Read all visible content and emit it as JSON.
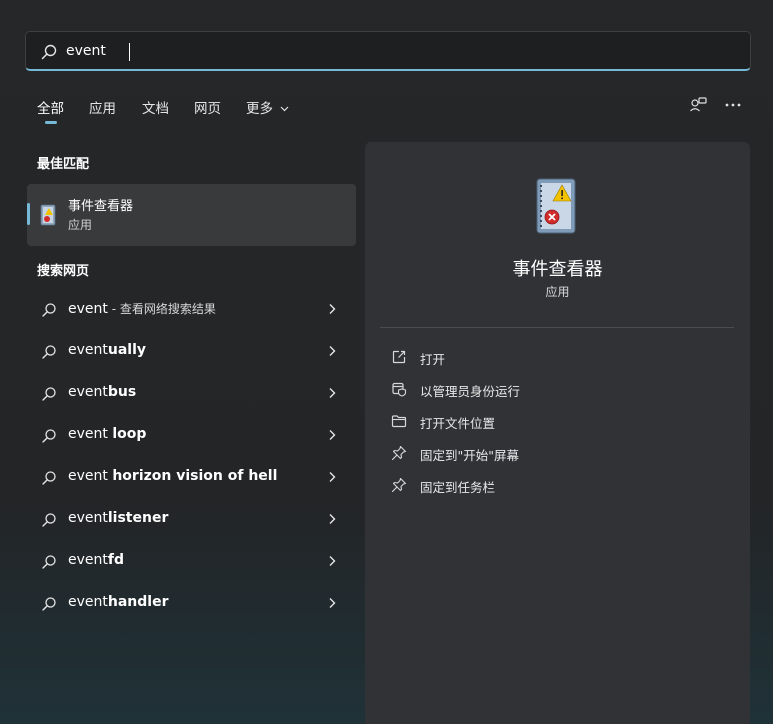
{
  "search": {
    "value": "event",
    "placeholder": ""
  },
  "tabs": [
    {
      "label": "全部",
      "active": true
    },
    {
      "label": "应用"
    },
    {
      "label": "文档"
    },
    {
      "label": "网页"
    },
    {
      "label": "更多"
    }
  ],
  "sections": {
    "best_match": "最佳匹配",
    "web_search": "搜索网页"
  },
  "best_match": {
    "name": "事件查看器",
    "type": "应用"
  },
  "web_results": [
    {
      "prefix": "event",
      "bold": "",
      "suffix": " - 查看网络搜索结果"
    },
    {
      "prefix": "event",
      "bold": "ually",
      "suffix": ""
    },
    {
      "prefix": "event",
      "bold": "bus",
      "suffix": ""
    },
    {
      "prefix": "event ",
      "bold": "loop",
      "suffix": ""
    },
    {
      "prefix": "event ",
      "bold": "horizon vision of hell",
      "suffix": ""
    },
    {
      "prefix": "event",
      "bold": "listener",
      "suffix": ""
    },
    {
      "prefix": "event",
      "bold": "fd",
      "suffix": ""
    },
    {
      "prefix": "event",
      "bold": "handler",
      "suffix": ""
    }
  ],
  "detail": {
    "name": "事件查看器",
    "type": "应用",
    "actions": [
      {
        "label": "打开",
        "icon": "open-external-icon"
      },
      {
        "label": "以管理员身份运行",
        "icon": "shield-admin-icon"
      },
      {
        "label": "打开文件位置",
        "icon": "folder-icon"
      },
      {
        "label": "固定到\"开始\"屏幕",
        "icon": "pin-icon"
      },
      {
        "label": "固定到任务栏",
        "icon": "pin-icon"
      }
    ]
  },
  "colors": {
    "accent": "#76b9d6",
    "panel": "#303236",
    "background": "#262729"
  }
}
